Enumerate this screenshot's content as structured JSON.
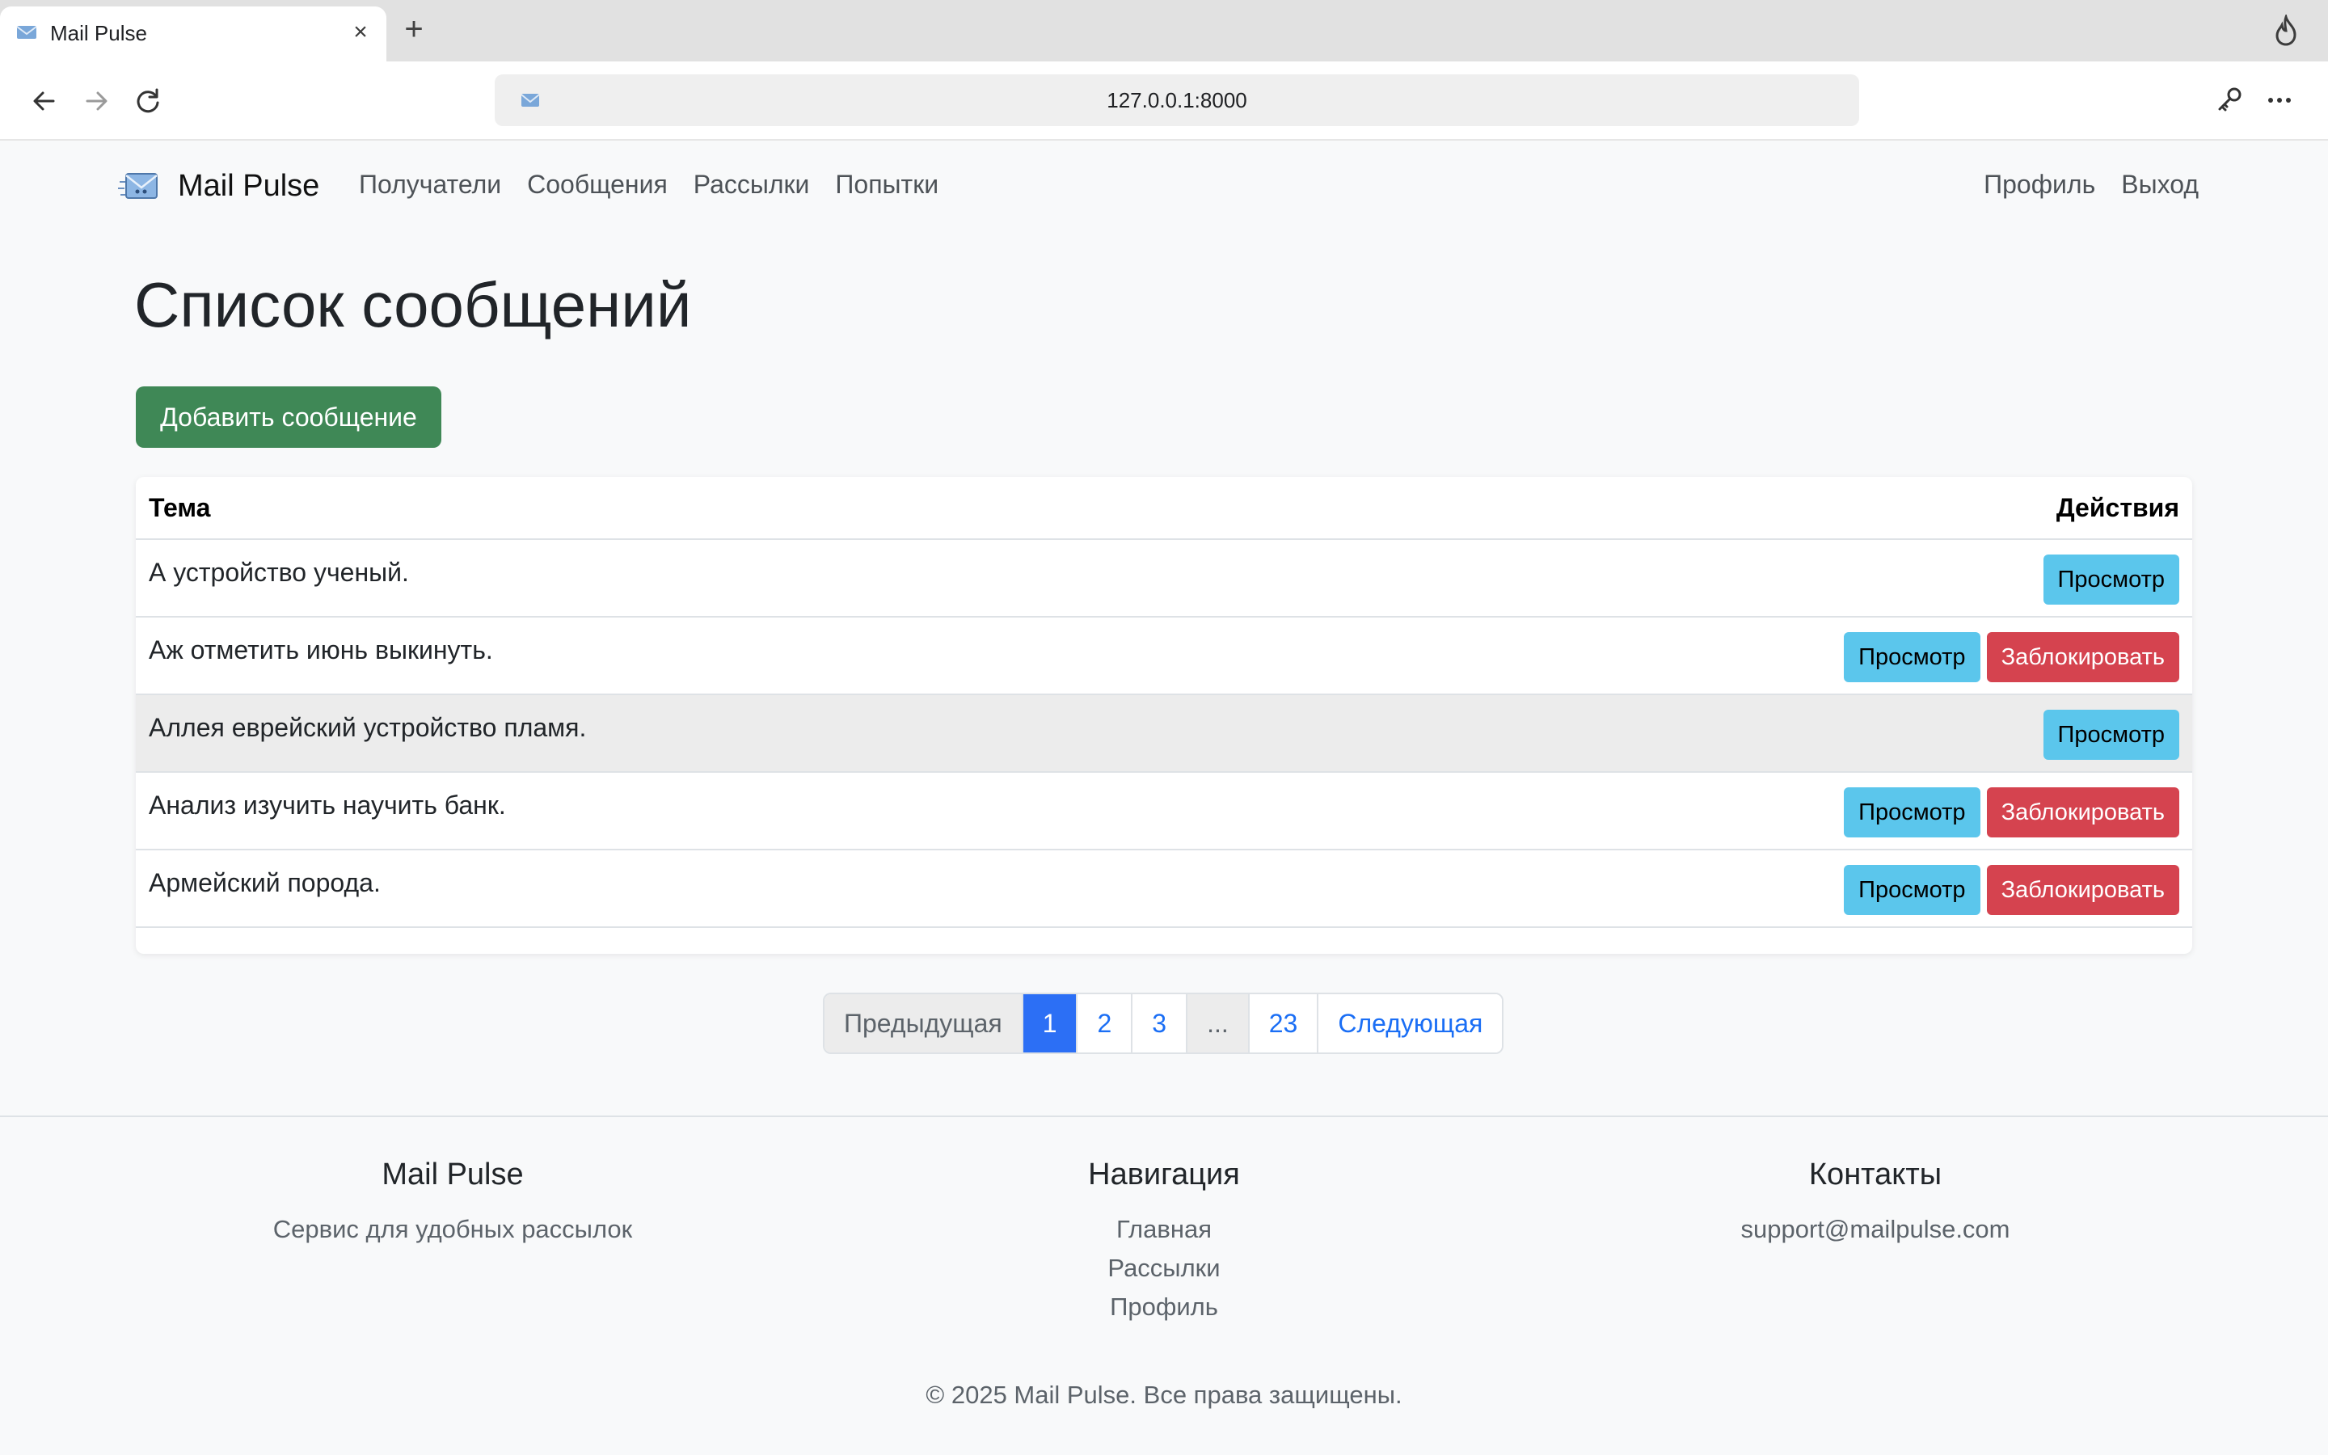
{
  "browser": {
    "tab_title": "Mail Pulse",
    "tab_close": "×",
    "new_tab": "+",
    "url": "127.0.0.1:8000"
  },
  "navbar": {
    "brand": "Mail Pulse",
    "links": [
      "Получатели",
      "Сообщения",
      "Рассылки",
      "Попытки"
    ],
    "right_links": [
      "Профиль",
      "Выход"
    ]
  },
  "main": {
    "title": "Список сообщений",
    "add_button": "Добавить сообщение",
    "table": {
      "headers": {
        "subject": "Тема",
        "actions": "Действия"
      },
      "rows": [
        {
          "subject": "А устройство ученый.",
          "view": "Просмотр",
          "block": ""
        },
        {
          "subject": "Аж отметить июнь выкинуть.",
          "view": "Просмотр",
          "block": "Заблокировать"
        },
        {
          "subject": "Аллея еврейский устройство пламя.",
          "view": "Просмотр",
          "block": ""
        },
        {
          "subject": "Анализ изучить научить банк.",
          "view": "Просмотр",
          "block": "Заблокировать"
        },
        {
          "subject": "Армейский порода.",
          "view": "Просмотр",
          "block": "Заблокировать"
        }
      ]
    },
    "pagination": {
      "prev": "Предыдущая",
      "pages": [
        "1",
        "2",
        "3",
        "...",
        "23"
      ],
      "next": "Следующая",
      "current": "1"
    }
  },
  "footer": {
    "col1": {
      "title": "Mail Pulse",
      "text": "Сервис для удобных рассылок"
    },
    "col2": {
      "title": "Навигация",
      "links": [
        "Главная",
        "Рассылки",
        "Профиль"
      ]
    },
    "col3": {
      "title": "Контакты",
      "email": "support@mailpulse.com"
    },
    "copyright": "© 2025 Mail Pulse. Все права защищены."
  },
  "colors": {
    "success": "#3f8856",
    "info": "#5bc6ec",
    "danger": "#d5434f",
    "primary": "#2c6ff5"
  },
  "icons": [
    "envelope-icon",
    "back-arrow-icon",
    "forward-arrow-icon",
    "reload-icon",
    "key-icon",
    "more-icon",
    "flame-icon"
  ]
}
